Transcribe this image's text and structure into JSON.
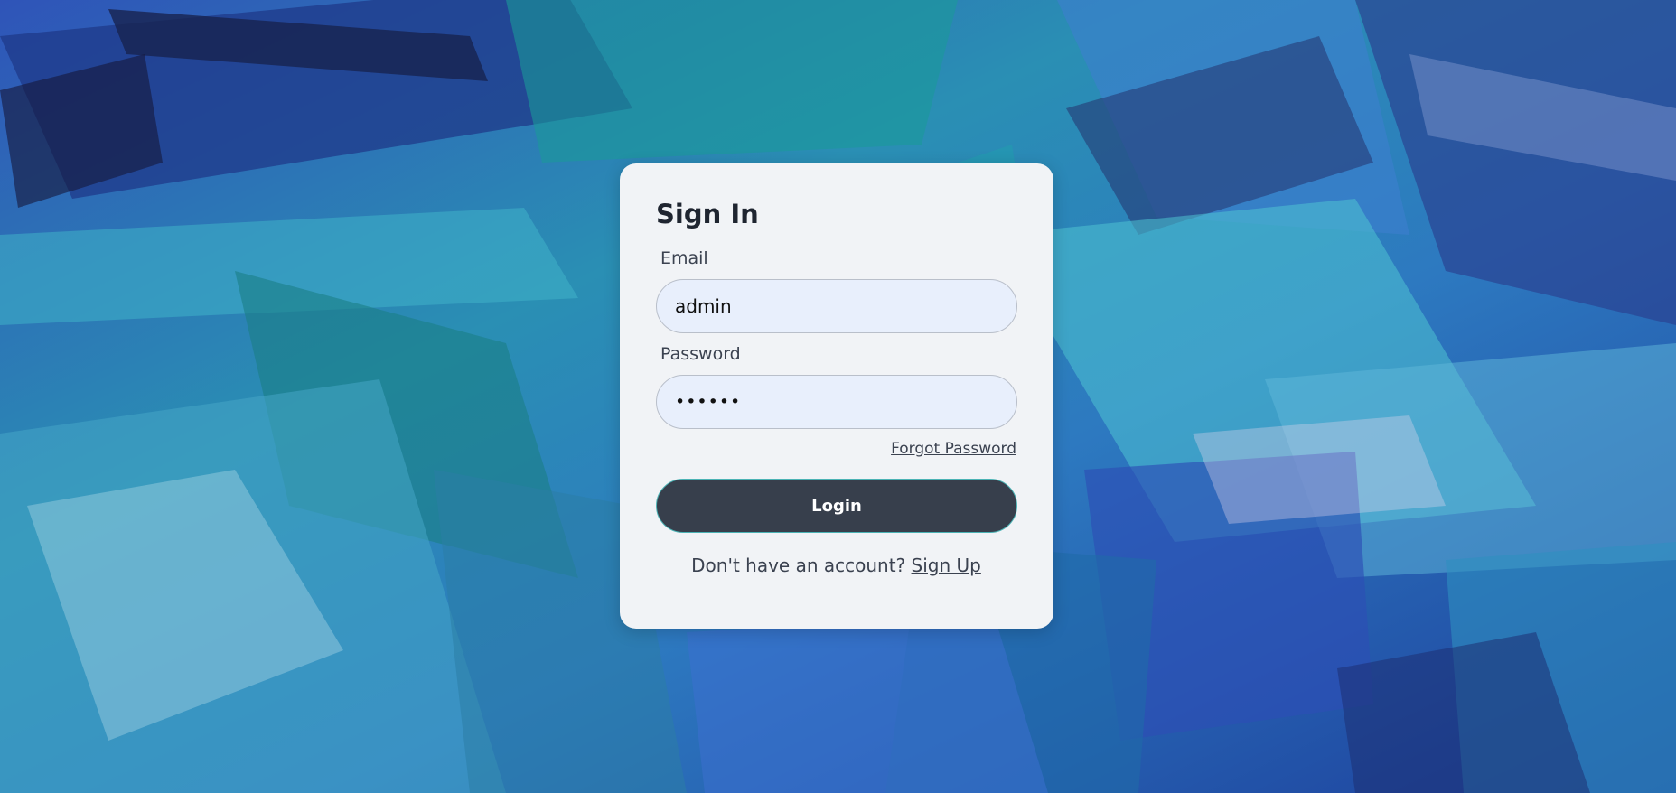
{
  "signin": {
    "title": "Sign In",
    "email_label": "Email",
    "email_value": "admin",
    "password_label": "Password",
    "password_value": "••••••",
    "forgot_password": "Forgot Password",
    "login_button": "Login",
    "signup_prompt": "Don't have an account?",
    "signup_link": "Sign Up"
  },
  "colors": {
    "card_background": "#f1f3f6",
    "input_background": "#e8effc",
    "button_background": "#373f4c",
    "button_text": "#ffffff",
    "title_text": "#1f2530"
  }
}
